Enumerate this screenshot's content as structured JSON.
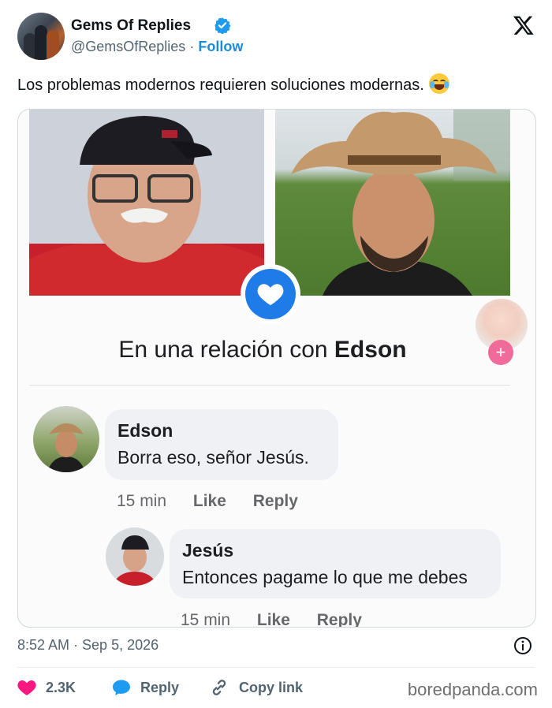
{
  "author": {
    "name": "Gems Of Replies",
    "handle": "@GemsOfReplies",
    "separator": "·",
    "follow_label": "Follow",
    "verified_color": "#1d9bf0"
  },
  "tweet": {
    "text": "Los problemas modernos requieren soluciones modernas.",
    "emoji": "face-with-tears-of-joy"
  },
  "image": {
    "relationship_prefix": "En una relación con",
    "relationship_name": "Edson",
    "heart_color": "#1f7be8",
    "comments": [
      {
        "name": "Edson",
        "text": "Borra eso, señor Jesús.",
        "time": "15 min",
        "like_label": "Like",
        "reply_label": "Reply"
      },
      {
        "name": "Jesús",
        "text": "Entonces pagame lo que me debes",
        "time": "15 min",
        "like_label": "Like",
        "reply_label": "Reply"
      }
    ]
  },
  "footer": {
    "timestamp": "8:52 AM · Sep 5, 2026",
    "likes": "2.3K",
    "reply_label": "Reply",
    "copy_link_label": "Copy link",
    "like_color": "#f91880",
    "reply_color": "#1d9bf0"
  },
  "watermark": "boredpanda.com"
}
